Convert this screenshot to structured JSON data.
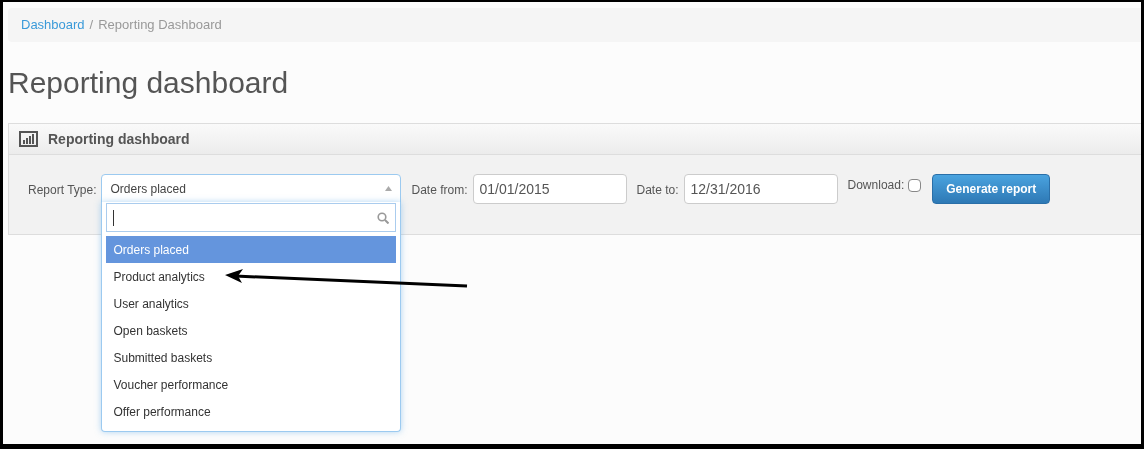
{
  "breadcrumb_separator": "/",
  "breadcrumb": [
    {
      "label": "Dashboard",
      "kind": "link"
    },
    {
      "label": "Reporting Dashboard",
      "kind": "current"
    }
  ],
  "page_title": "Reporting dashboard",
  "panel": {
    "title": "Reporting dashboard",
    "report_type": {
      "label": "Report Type:",
      "value": "Orders placed",
      "expanded": true,
      "options": [
        {
          "label": "Orders placed",
          "selected": true
        },
        {
          "label": "Product analytics",
          "selected": false
        },
        {
          "label": "User analytics",
          "selected": false
        },
        {
          "label": "Open baskets",
          "selected": false
        },
        {
          "label": "Submitted baskets",
          "selected": false
        },
        {
          "label": "Voucher performance",
          "selected": false
        },
        {
          "label": "Offer performance",
          "selected": false
        }
      ]
    },
    "date_from": {
      "label": "Date from:",
      "value": "01/01/2015"
    },
    "date_to": {
      "label": "Date to:",
      "value": "12/31/2016"
    },
    "download": {
      "label": "Download:",
      "checked": false
    },
    "button": "Generate report"
  }
}
